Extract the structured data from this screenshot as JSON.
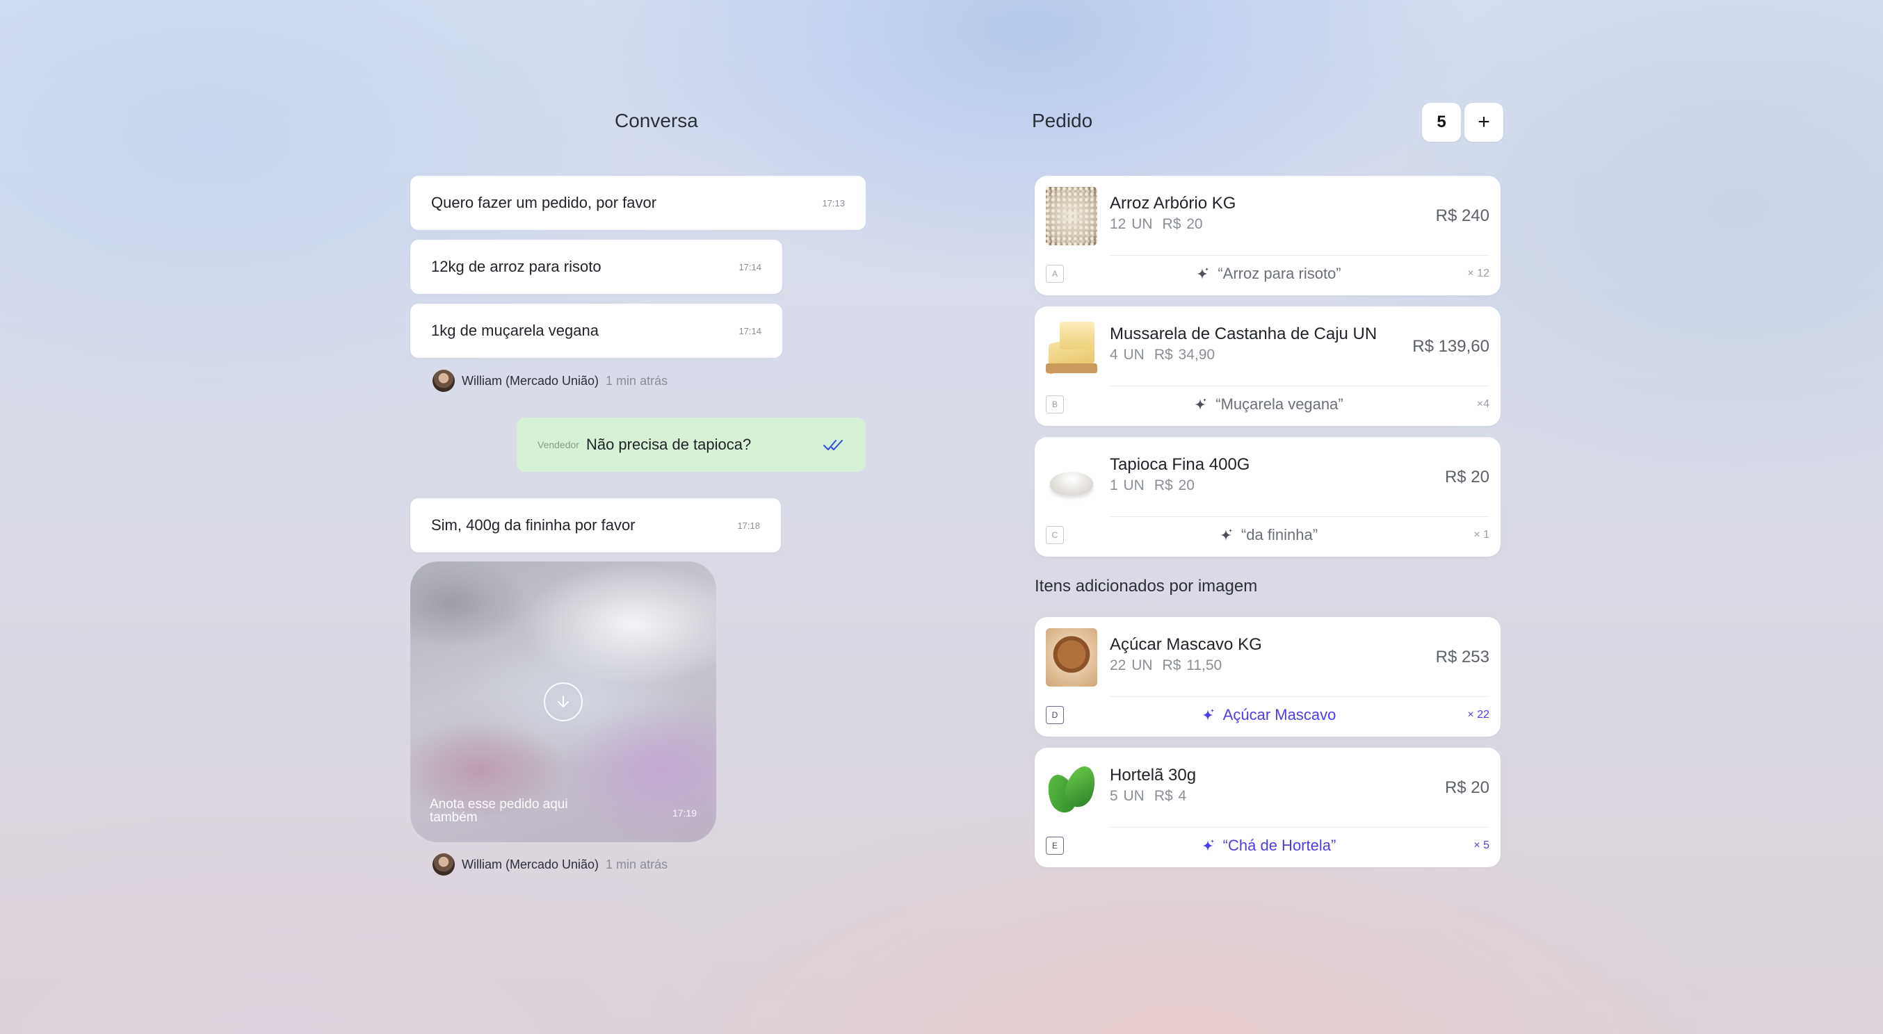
{
  "chat": {
    "title": "Conversa",
    "messages": [
      {
        "text": "Quero fazer um pedido, por favor",
        "time": "17:13"
      },
      {
        "text": "12kg de arroz para risoto",
        "time": "17:14"
      },
      {
        "text": "1kg de muçarela vegana",
        "time": "17:14"
      },
      {
        "text": "Sim, 400g da fininha por favor",
        "time": "17:18"
      }
    ],
    "sender": {
      "name": "William (Mercado União)",
      "ago": "1 min atrás"
    },
    "seller": {
      "tag": "Vendedor",
      "text": "Não precisa de tapioca?"
    },
    "image_message": {
      "caption": "Anota esse pedido aqui também",
      "time": "17:19"
    }
  },
  "order": {
    "title": "Pedido",
    "count": "5",
    "add_label": "+",
    "items": [
      {
        "name": "Arroz Arbório KG",
        "qty": "12 UN",
        "unit_price": "R$ 20",
        "total": "R$ 240",
        "letter": "A",
        "match": "“Arroz para risoto”",
        "mult": "× 12",
        "thumb_icon": "rice-thumbnail"
      },
      {
        "name": "Mussarela de Castanha de Caju UN",
        "qty": "4 UN",
        "unit_price": "R$ 34,90",
        "total": "R$ 139,60",
        "letter": "B",
        "match": "“Muçarela vegana”",
        "mult": "×4",
        "thumb_icon": "cheese-thumbnail"
      },
      {
        "name": "Tapioca Fina 400G",
        "qty": "1 UN",
        "unit_price": "R$ 20",
        "total": "R$ 20",
        "letter": "C",
        "match": "“da fininha”",
        "mult": "× 1",
        "thumb_icon": "tapioca-thumbnail"
      }
    ],
    "image_section_title": "Itens adicionados por imagem",
    "image_items": [
      {
        "name": "Açúcar Mascavo KG",
        "qty": "22 UN",
        "unit_price": "R$ 11,50",
        "total": "R$ 253",
        "letter": "D",
        "match": "Açúcar Mascavo",
        "mult": "× 22",
        "thumb_icon": "sugar-thumbnail"
      },
      {
        "name": "Hortelã 30g",
        "qty": "5 UN",
        "unit_price": "R$ 4",
        "total": "R$ 20",
        "letter": "E",
        "match": "“Chá de Hortela”",
        "mult": "× 5",
        "thumb_icon": "mint-thumbnail"
      }
    ]
  },
  "colors": {
    "accent": "#4b3ee8",
    "seller_bubble": "#d6f1d6",
    "check": "#2f4fe0"
  }
}
